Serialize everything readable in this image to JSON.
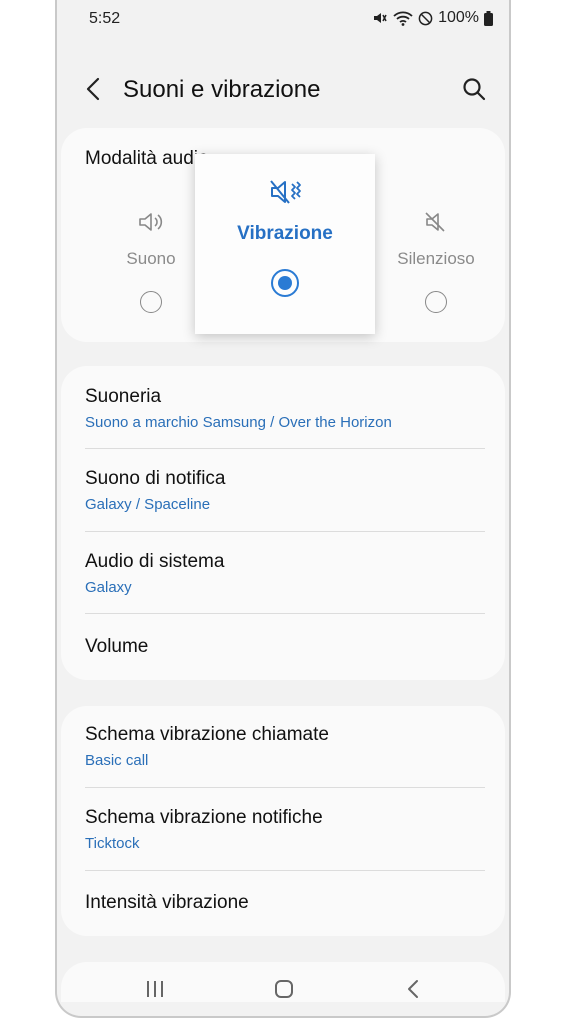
{
  "status": {
    "time": "5:52",
    "battery": "100%"
  },
  "header": {
    "title": "Suoni e vibrazione"
  },
  "sound_mode": {
    "label": "Modalità audio",
    "options": [
      {
        "label": "Suono",
        "selected": false
      },
      {
        "label": "Vibrazione",
        "selected": true
      },
      {
        "label": "Silenzioso",
        "selected": false
      }
    ]
  },
  "sound_settings": [
    {
      "title": "Suoneria",
      "subtitle": "Suono a marchio Samsung / Over the Horizon"
    },
    {
      "title": "Suono di notifica",
      "subtitle": "Galaxy / Spaceline"
    },
    {
      "title": "Audio di sistema",
      "subtitle": "Galaxy"
    },
    {
      "title": "Volume"
    }
  ],
  "vibration_settings": [
    {
      "title": "Schema vibrazione chiamate",
      "subtitle": "Basic call"
    },
    {
      "title": "Schema vibrazione notifiche",
      "subtitle": "Ticktock"
    },
    {
      "title": "Intensità vibrazione"
    }
  ],
  "colors": {
    "accent": "#2a7bd4",
    "subtitle": "#2a6fb8",
    "background": "#f2f2f2",
    "card": "#fafafa"
  },
  "icons": [
    "back-arrow-icon",
    "search-icon",
    "sound-icon",
    "vibrate-icon",
    "mute-icon",
    "recents-icon",
    "home-icon",
    "nav-back-icon"
  ]
}
